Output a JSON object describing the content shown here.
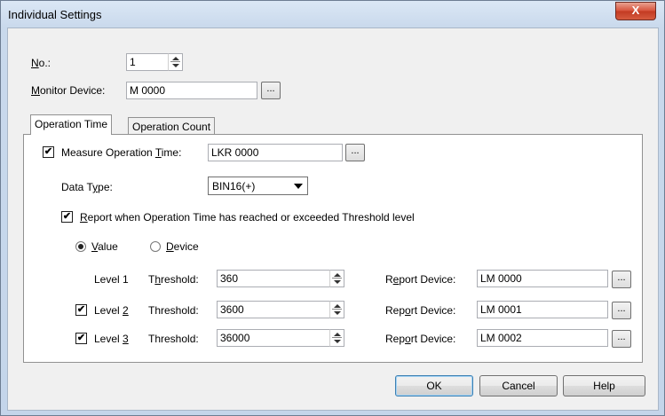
{
  "window": {
    "title": "Individual Settings",
    "close_glyph": "X"
  },
  "no_field": {
    "label_u": "N",
    "label_rest": "o.:",
    "value": "1"
  },
  "monitor": {
    "label_u": "M",
    "label_rest": "onitor Device:",
    "value": "M 0000",
    "browse_label": "..."
  },
  "tabs": [
    {
      "label": "Operation Time",
      "active": true
    },
    {
      "label": "Operation Count",
      "active": false
    }
  ],
  "measure": {
    "checked": true,
    "check_glyph": "✔",
    "label_pre": "Measure Operation ",
    "label_u": "T",
    "label_post": "ime:",
    "value": "LKR 0000",
    "browse_label": "..."
  },
  "data_type": {
    "label_pre": "Data T",
    "label_u": "y",
    "label_post": "pe:",
    "value": "BIN16(+)"
  },
  "report": {
    "checked": true,
    "label_u": "R",
    "label_rest": "eport when Operation Time has reached or exceeded Threshold level"
  },
  "mode": {
    "value_u": "V",
    "value_rest": "alue",
    "device_u": "D",
    "device_rest": "evice",
    "selected": "value"
  },
  "levels": [
    {
      "label_pre": "Level 1",
      "label_u": "",
      "has_checkbox": false,
      "checked": false,
      "threshold_label_pre": "T",
      "threshold_label_u": "h",
      "threshold_label_post": "reshold:",
      "threshold": "360",
      "report_label_pre": "R",
      "report_label_u": "e",
      "report_label_post": "port Device:",
      "report_device": "LM 0000"
    },
    {
      "label_pre": "Level ",
      "label_u": "2",
      "has_checkbox": true,
      "checked": true,
      "threshold_label_pre": "Threshold:",
      "threshold_label_u": "",
      "threshold_label_post": "",
      "threshold": "3600",
      "report_label_pre": "Rep",
      "report_label_u": "o",
      "report_label_post": "rt Device:",
      "report_device": "LM 0001"
    },
    {
      "label_pre": "Level ",
      "label_u": "3",
      "has_checkbox": true,
      "checked": true,
      "threshold_label_pre": "Threshold:",
      "threshold_label_u": "",
      "threshold_label_post": "",
      "threshold": "36000",
      "report_label_pre": "Rep",
      "report_label_u": "o",
      "report_label_post": "rt Device:",
      "report_device": "LM 0002"
    }
  ],
  "buttons": {
    "ok": "OK",
    "cancel": "Cancel",
    "help": "Help"
  },
  "colors": {
    "title_bar": "#c9d9ec",
    "close_button": "#c94a30",
    "panel_bg": "#ffffff",
    "dialog_bg": "#f0f0f0"
  }
}
